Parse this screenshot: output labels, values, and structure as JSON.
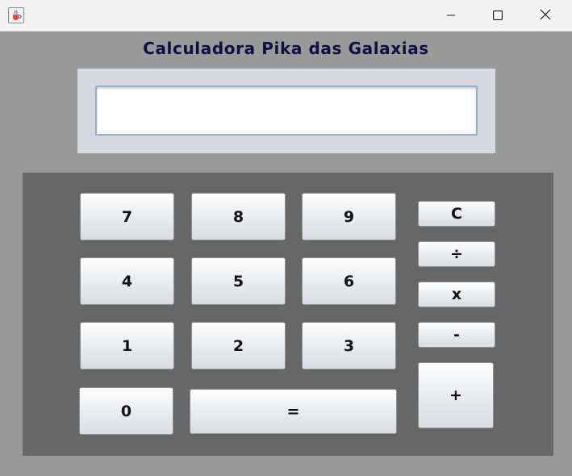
{
  "window": {
    "icon": "java-cup-icon",
    "controls": [
      "minimize-icon",
      "maximize-icon",
      "close-icon"
    ]
  },
  "app": {
    "title": "Calculadora Pika das Galaxias"
  },
  "display": {
    "value": "",
    "placeholder": ""
  },
  "keys": {
    "seven": "7",
    "eight": "8",
    "nine": "9",
    "four": "4",
    "five": "5",
    "six": "6",
    "one": "1",
    "two": "2",
    "three": "3",
    "zero": "0",
    "equals": "=",
    "clear": "C",
    "divide": "÷",
    "multiply": "x",
    "subtract": "-",
    "add": "+"
  },
  "colors": {
    "window_bg": "#999999",
    "keypad_bg": "#676767",
    "display_panel_bg": "#d6d9df",
    "title_color": "#0e0e40"
  }
}
